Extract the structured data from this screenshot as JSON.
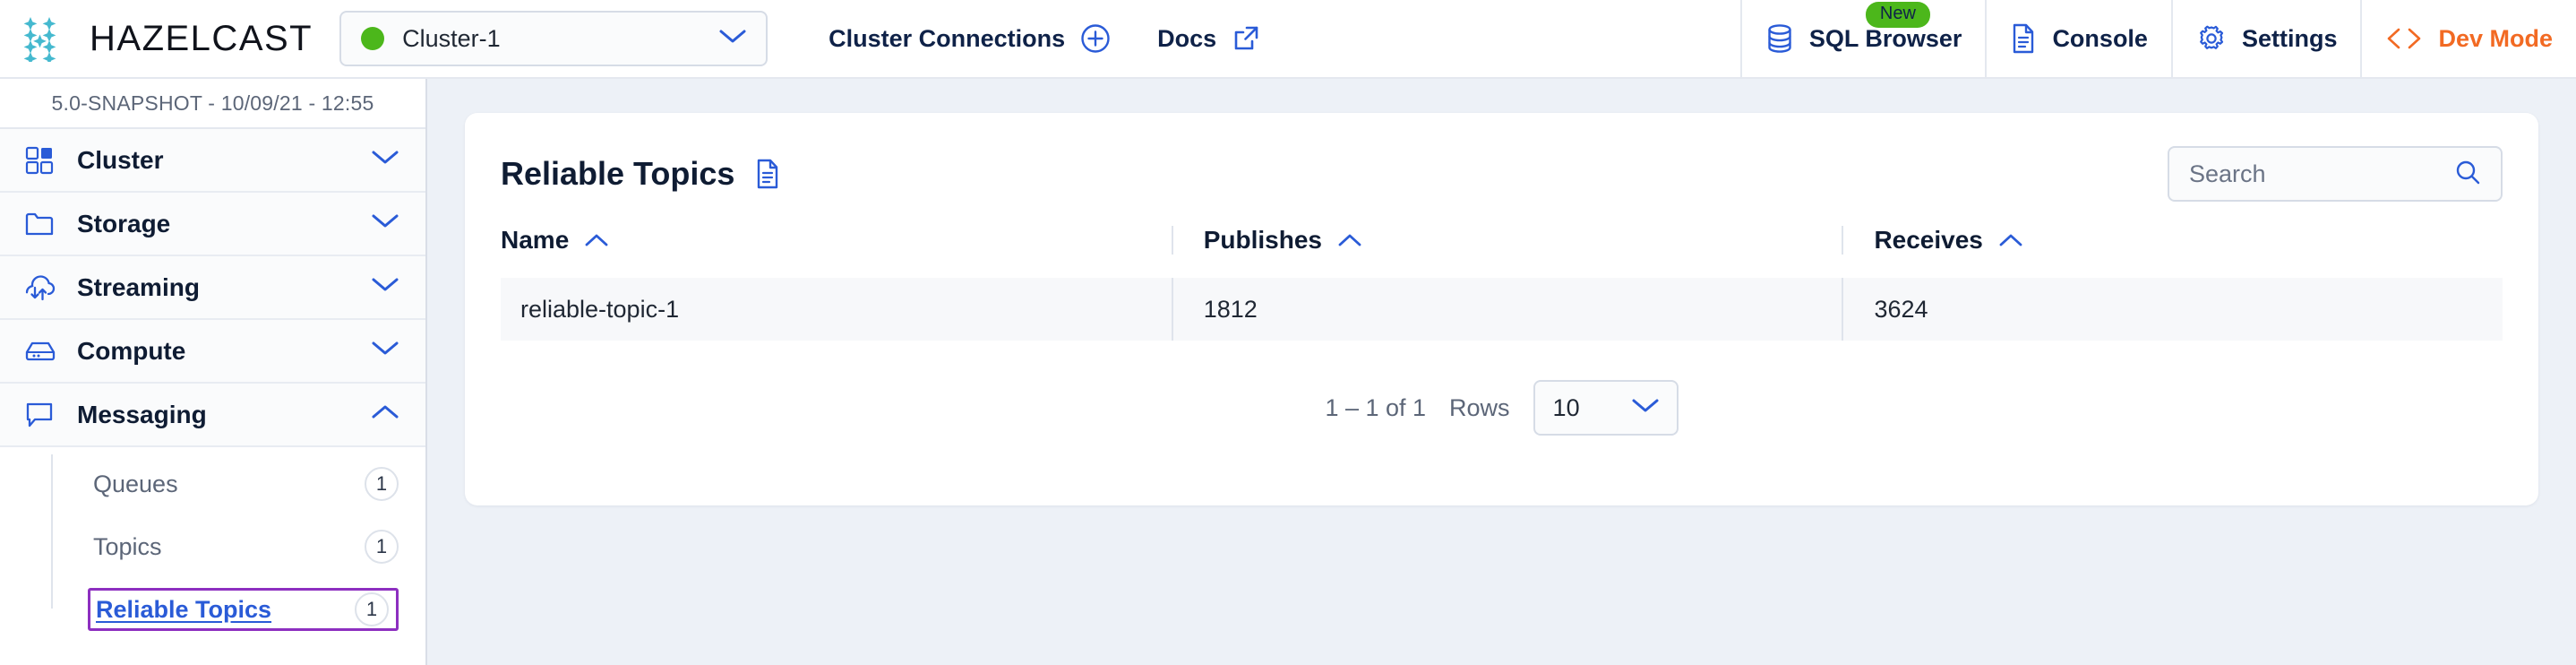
{
  "brand": {
    "name": "HAZELCAST",
    "logo_icon": "hazelcast-sparkle-logo"
  },
  "topbar": {
    "cluster_selector": {
      "name": "Cluster-1",
      "status_icon": "green-status-dot",
      "status_color": "#4cb71b",
      "chevron_icon": "chevron-down-icon"
    },
    "items": [
      {
        "label": "Cluster Connections",
        "icon": "plus-circle-icon",
        "icon_side": "right"
      },
      {
        "label": "Docs",
        "icon": "external-link-icon",
        "icon_side": "right"
      },
      {
        "label": "SQL Browser",
        "icon": "database-icon",
        "icon_side": "left",
        "badge": "New"
      },
      {
        "label": "Console",
        "icon": "document-lines-icon",
        "icon_side": "left"
      },
      {
        "label": "Settings",
        "icon": "gear-icon",
        "icon_side": "left"
      },
      {
        "label": "Dev Mode",
        "icon": "code-brackets-icon",
        "icon_side": "left",
        "color": "#f26a23"
      }
    ]
  },
  "sidebar": {
    "version": "5.0-SNAPSHOT - 10/09/21 - 12:55",
    "sections": [
      {
        "label": "Cluster",
        "icon": "grid-squares-icon",
        "expanded": false,
        "chevron": "chevron-down-icon"
      },
      {
        "label": "Storage",
        "icon": "folder-icon",
        "expanded": false,
        "chevron": "chevron-down-icon"
      },
      {
        "label": "Streaming",
        "icon": "cloud-arrows-icon",
        "expanded": false,
        "chevron": "chevron-down-icon"
      },
      {
        "label": "Compute",
        "icon": "server-icon",
        "expanded": false,
        "chevron": "chevron-down-icon"
      },
      {
        "label": "Messaging",
        "icon": "speech-bubble-icon",
        "expanded": true,
        "chevron": "chevron-up-icon"
      }
    ],
    "messaging_items": [
      {
        "label": "Queues",
        "count": "1",
        "active": false
      },
      {
        "label": "Topics",
        "count": "1",
        "active": false
      },
      {
        "label": "Reliable Topics",
        "count": "1",
        "active": true
      }
    ],
    "active_highlight_color": "#8d2fc0",
    "active_link_color": "#2a5bd7"
  },
  "main": {
    "card": {
      "title": "Reliable Topics",
      "title_icon": "document-lines-icon",
      "search": {
        "placeholder": "Search",
        "value": "",
        "icon": "search-icon"
      },
      "table": {
        "columns": [
          {
            "label": "Name",
            "sort_icon": "chevron-up-icon"
          },
          {
            "label": "Publishes",
            "sort_icon": "chevron-up-icon"
          },
          {
            "label": "Receives",
            "sort_icon": "chevron-up-icon"
          }
        ],
        "rows": [
          {
            "name": "reliable-topic-1",
            "publishes": "1812",
            "receives": "3624"
          }
        ]
      },
      "pagination": {
        "range": "1 – 1 of 1",
        "rows_label": "Rows",
        "rows_value": "10",
        "chevron_icon": "chevron-down-icon"
      }
    }
  }
}
